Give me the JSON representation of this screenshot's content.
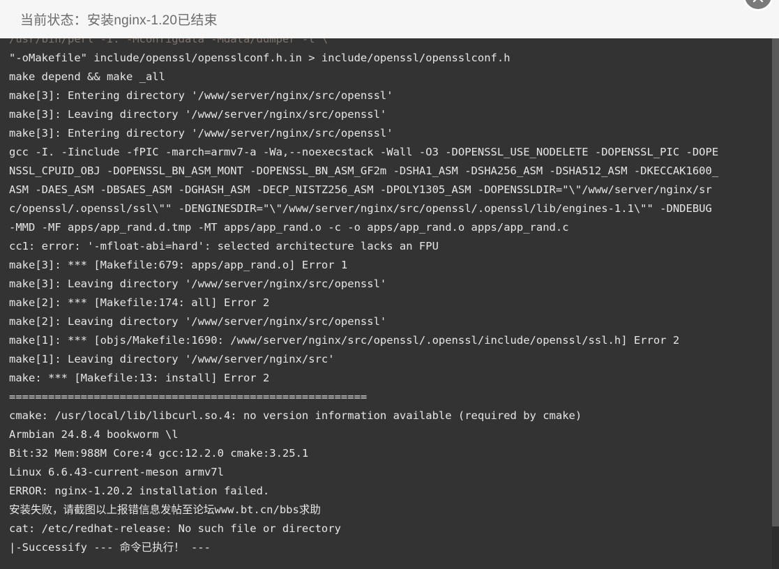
{
  "header": {
    "status_label": "当前状态：安装nginx-1.20已结束",
    "close_icon": "chevron-up-icon"
  },
  "terminal": {
    "background_color": "#333333",
    "text_color": "#e6e6e6",
    "lines": [
      "/usr/bin/perl -I. -Mconfigdata -Mdata/dumper -l \\",
      "\"-oMakefile\" include/openssl/opensslconf.h.in > include/openssl/opensslconf.h",
      "make depend && make _all",
      "make[3]: Entering directory '/www/server/nginx/src/openssl'",
      "make[3]: Leaving directory '/www/server/nginx/src/openssl'",
      "make[3]: Entering directory '/www/server/nginx/src/openssl'",
      "gcc -I. -Iinclude -fPIC -march=armv7-a -Wa,--noexecstack -Wall -O3 -DOPENSSL_USE_NODELETE -DOPENSSL_PIC -DOPE",
      "NSSL_CPUID_OBJ -DOPENSSL_BN_ASM_MONT -DOPENSSL_BN_ASM_GF2m -DSHA1_ASM -DSHA256_ASM -DSHA512_ASM -DKECCAK1600_",
      "ASM -DAES_ASM -DBSAES_ASM -DGHASH_ASM -DECP_NISTZ256_ASM -DPOLY1305_ASM -DOPENSSLDIR=\"\\\"/www/server/nginx/sr",
      "c/openssl/.openssl/ssl\\\"\" -DENGINESDIR=\"\\\"/www/server/nginx/src/openssl/.openssl/lib/engines-1.1\\\"\" -DNDEBUG",
      "-MMD -MF apps/app_rand.d.tmp -MT apps/app_rand.o -c -o apps/app_rand.o apps/app_rand.c",
      "cc1: error: '-mfloat-abi=hard': selected architecture lacks an FPU",
      "make[3]: *** [Makefile:679: apps/app_rand.o] Error 1",
      "make[3]: Leaving directory '/www/server/nginx/src/openssl'",
      "make[2]: *** [Makefile:174: all] Error 2",
      "make[2]: Leaving directory '/www/server/nginx/src/openssl'",
      "make[1]: *** [objs/Makefile:1690: /www/server/nginx/src/openssl/.openssl/include/openssl/ssl.h] Error 2",
      "make[1]: Leaving directory '/www/server/nginx/src'",
      "make: *** [Makefile:13: install] Error 2",
      "=======================================================",
      "cmake: /usr/local/lib/libcurl.so.4: no version information available (required by cmake)",
      "Armbian 24.8.4 bookworm \\l",
      "Bit:32 Mem:988M Core:4 gcc:12.2.0 cmake:3.25.1",
      "Linux 6.6.43-current-meson armv7l",
      "ERROR: nginx-1.20.2 installation failed.",
      "安装失败，请截图以上报错信息发帖至论坛www.bt.cn/bbs求助",
      "cat: /etc/redhat-release: No such file or directory",
      "|-Successify --- 命令已执行！ ---"
    ]
  },
  "scrollbar": {
    "orientation": "vertical",
    "thumb_color": "#5a5a5a"
  }
}
